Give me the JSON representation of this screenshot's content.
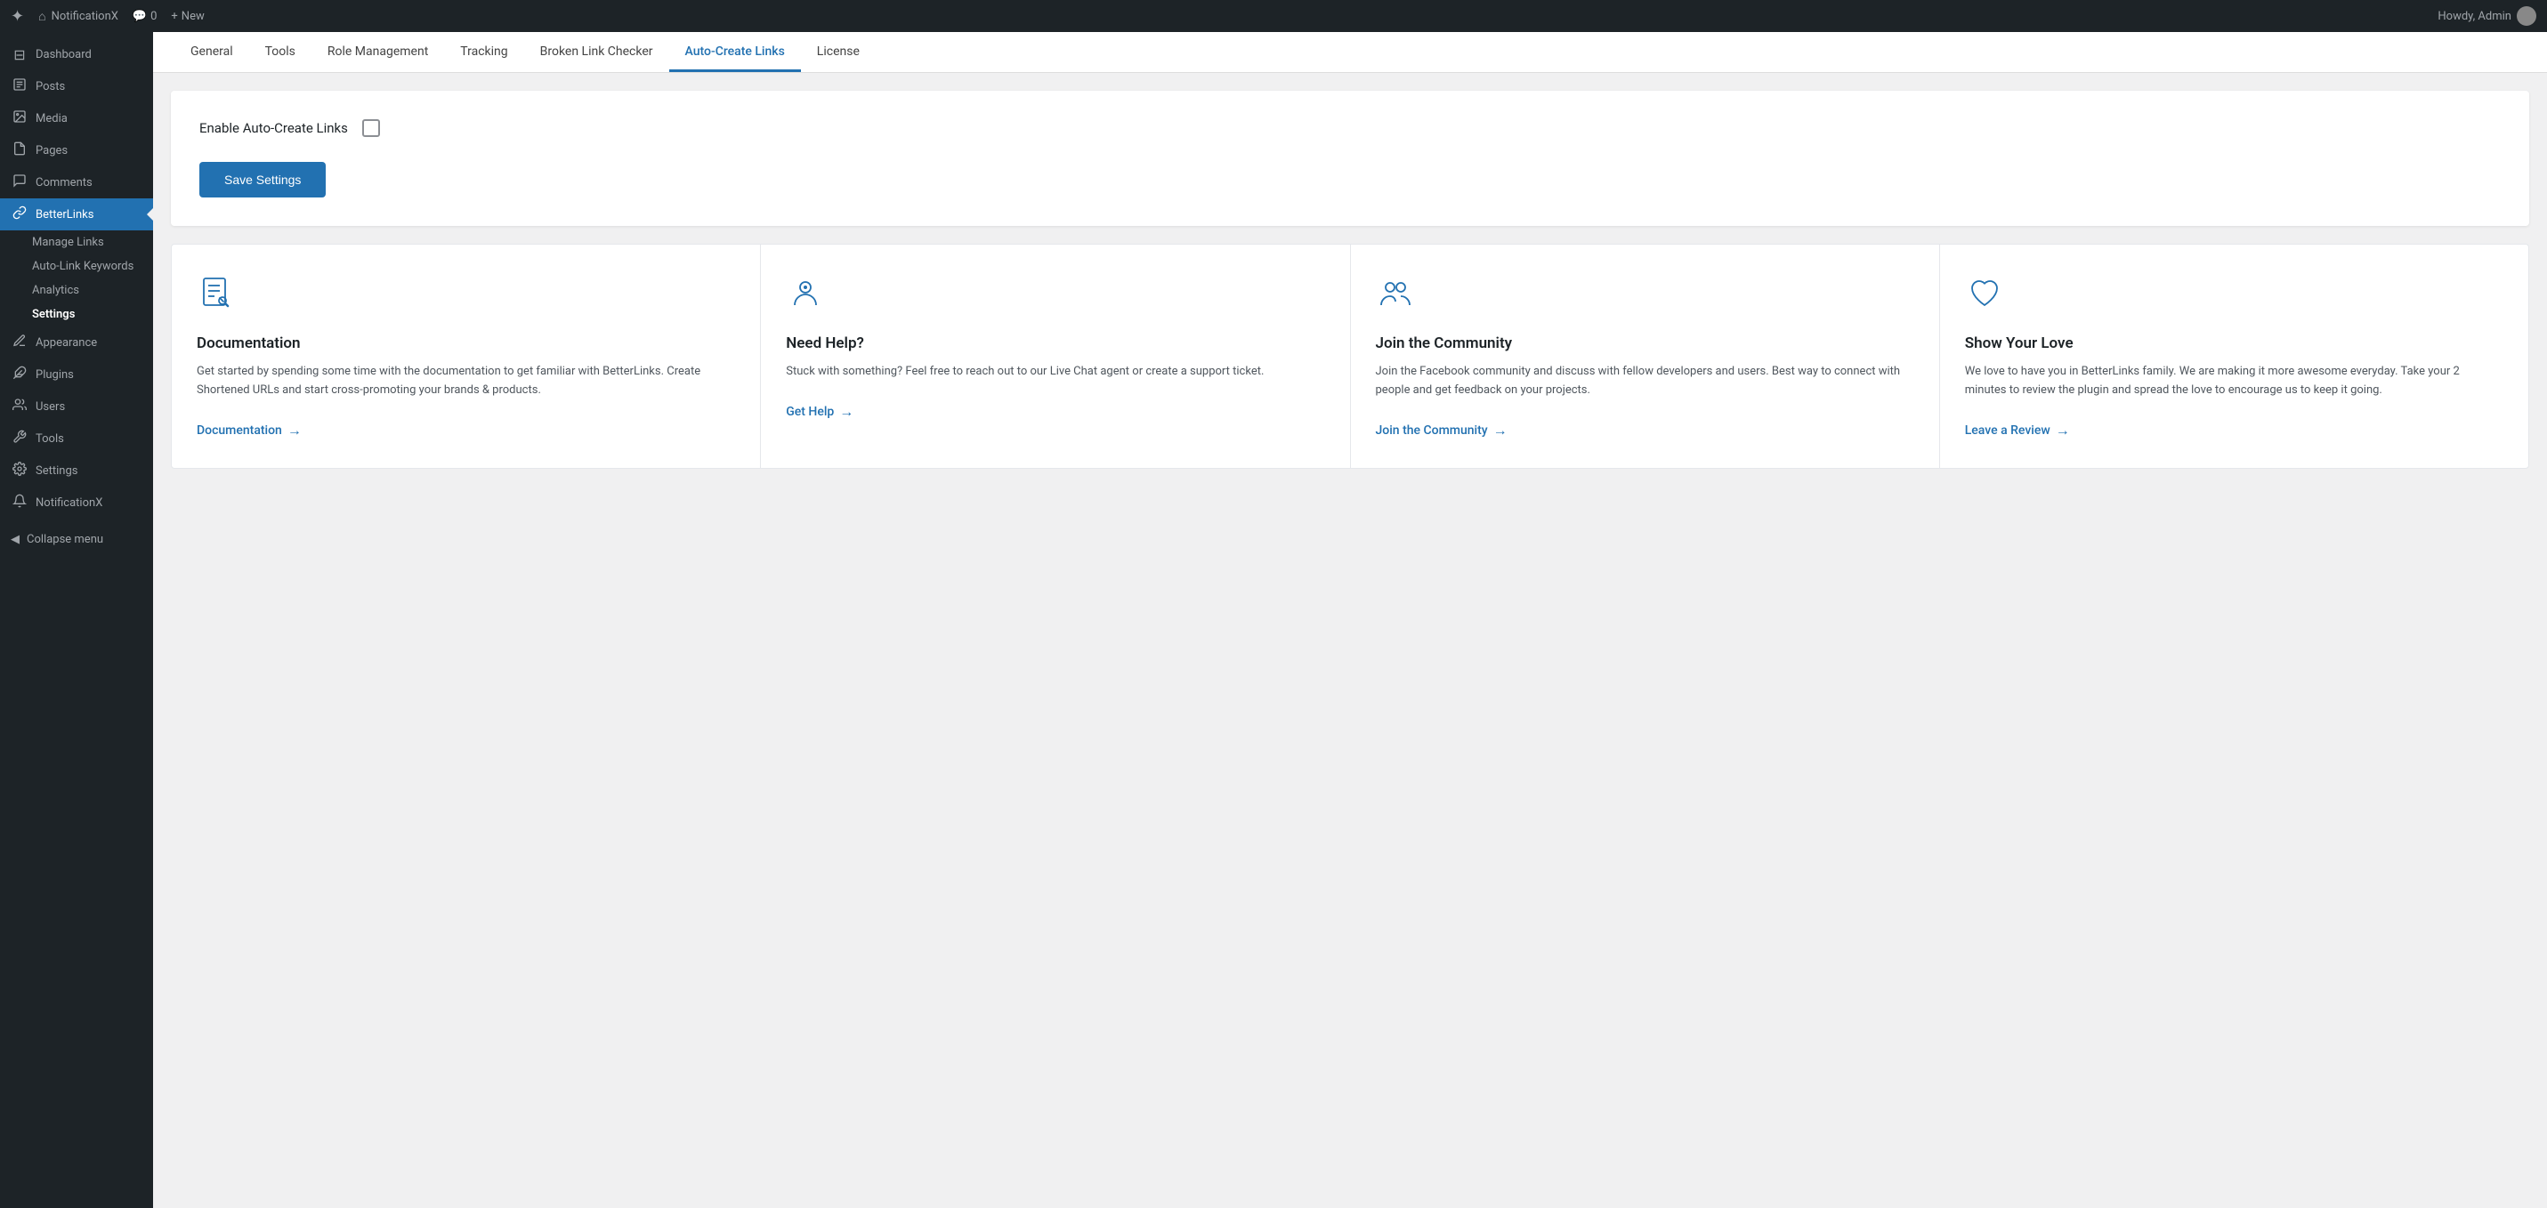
{
  "adminbar": {
    "wp_logo": "⊞",
    "site_name": "NotificationX",
    "home_icon": "⌂",
    "comments_label": "0",
    "new_label": "New",
    "howdy": "Howdy, Admin"
  },
  "sidebar": {
    "items": [
      {
        "id": "dashboard",
        "label": "Dashboard",
        "icon": "⊟"
      },
      {
        "id": "posts",
        "label": "Posts",
        "icon": "📄"
      },
      {
        "id": "media",
        "label": "Media",
        "icon": "🖼"
      },
      {
        "id": "pages",
        "label": "Pages",
        "icon": "📋"
      },
      {
        "id": "comments",
        "label": "Comments",
        "icon": "💬"
      },
      {
        "id": "betterlinks",
        "label": "BetterLinks",
        "icon": "🔗",
        "active": true
      }
    ],
    "betterlinks_sub": [
      {
        "id": "manage-links",
        "label": "Manage Links"
      },
      {
        "id": "auto-link-keywords",
        "label": "Auto-Link Keywords"
      },
      {
        "id": "analytics",
        "label": "Analytics"
      },
      {
        "id": "settings",
        "label": "Settings",
        "active": true
      }
    ],
    "other_items": [
      {
        "id": "appearance",
        "label": "Appearance",
        "icon": "🎨"
      },
      {
        "id": "plugins",
        "label": "Plugins",
        "icon": "🔌"
      },
      {
        "id": "users",
        "label": "Users",
        "icon": "👤"
      },
      {
        "id": "tools",
        "label": "Tools",
        "icon": "🔧"
      },
      {
        "id": "settings-wp",
        "label": "Settings",
        "icon": "⚙"
      },
      {
        "id": "notificationx",
        "label": "NotificationX",
        "icon": "🔔"
      }
    ],
    "collapse_label": "Collapse menu"
  },
  "tabs": [
    {
      "id": "general",
      "label": "General"
    },
    {
      "id": "tools",
      "label": "Tools"
    },
    {
      "id": "role-management",
      "label": "Role Management"
    },
    {
      "id": "tracking",
      "label": "Tracking"
    },
    {
      "id": "broken-link-checker",
      "label": "Broken Link Checker"
    },
    {
      "id": "auto-create-links",
      "label": "Auto-Create Links",
      "active": true
    },
    {
      "id": "license",
      "label": "License"
    }
  ],
  "settings": {
    "enable_label": "Enable Auto-Create Links",
    "save_label": "Save Settings"
  },
  "cards": [
    {
      "id": "documentation",
      "icon_type": "doc",
      "title": "Documentation",
      "desc": "Get started by spending some time with the documentation to get familiar with BetterLinks. Create Shortened URLs and start cross-promoting your brands & products.",
      "link_label": "Documentation",
      "link_href": "#"
    },
    {
      "id": "need-help",
      "icon_type": "support",
      "title": "Need Help?",
      "desc": "Stuck with something? Feel free to reach out to our Live Chat agent or create a support ticket.",
      "link_label": "Get Help",
      "link_href": "#"
    },
    {
      "id": "join-community",
      "icon_type": "community",
      "title": "Join the Community",
      "desc": "Join the Facebook community and discuss with fellow developers and users. Best way to connect with people and get feedback on your projects.",
      "link_label": "Join the Community",
      "link_href": "#"
    },
    {
      "id": "show-love",
      "icon_type": "heart",
      "title": "Show Your Love",
      "desc": "We love to have you in BetterLinks family. We are making it more awesome everyday. Take your 2 minutes to review the plugin and spread the love to encourage us to keep it going.",
      "link_label": "Leave a Review",
      "link_href": "#"
    }
  ]
}
